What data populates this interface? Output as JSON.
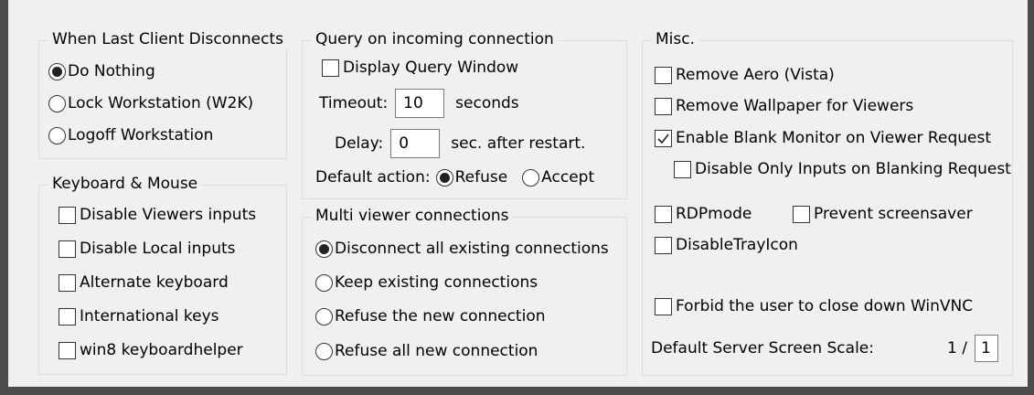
{
  "last_client": {
    "title": "When Last Client Disconnects",
    "options": [
      {
        "label": "Do Nothing",
        "selected": true
      },
      {
        "label": "Lock Workstation (W2K)",
        "selected": false
      },
      {
        "label": "Logoff Workstation",
        "selected": false
      }
    ]
  },
  "keyboard_mouse": {
    "title": "Keyboard & Mouse",
    "items": [
      {
        "label": "Disable Viewers inputs",
        "checked": false
      },
      {
        "label": "Disable Local inputs",
        "checked": false
      },
      {
        "label": "Alternate keyboard",
        "checked": false
      },
      {
        "label": "International keys",
        "checked": false
      },
      {
        "label": "win8 keyboardhelper",
        "checked": false
      }
    ]
  },
  "query": {
    "title": "Query on incoming connection",
    "display_query_window": {
      "label": "Display Query Window",
      "checked": false
    },
    "timeout_label": "Timeout:",
    "timeout_value": "10",
    "timeout_unit": "seconds",
    "delay_label": "Delay:",
    "delay_value": "0",
    "delay_unit": "sec. after restart.",
    "default_action_label": "Default action:",
    "actions": [
      {
        "label": "Refuse",
        "selected": true
      },
      {
        "label": "Accept",
        "selected": false
      }
    ]
  },
  "multi_viewer": {
    "title": "Multi viewer connections",
    "options": [
      {
        "label": "Disconnect all existing connections",
        "selected": true
      },
      {
        "label": "Keep existing connections",
        "selected": false
      },
      {
        "label": "Refuse the new connection",
        "selected": false
      },
      {
        "label": "Refuse all new connection",
        "selected": false
      }
    ]
  },
  "misc": {
    "title": "Misc.",
    "remove_aero": {
      "label": "Remove Aero (Vista)",
      "checked": false
    },
    "remove_wallpaper": {
      "label": "Remove Wallpaper for Viewers",
      "checked": false
    },
    "enable_blank": {
      "label": "Enable Blank Monitor on Viewer Request",
      "checked": true
    },
    "disable_only_inputs": {
      "label": "Disable Only Inputs on Blanking Request",
      "checked": false
    },
    "rdpmode": {
      "label": "RDPmode",
      "checked": false
    },
    "prevent_screensaver": {
      "label": "Prevent screensaver",
      "checked": false
    },
    "disable_tray_icon": {
      "label": "DisableTrayIcon",
      "checked": false
    },
    "forbid_close": {
      "label": "Forbid the user to close down WinVNC",
      "checked": false
    },
    "scale_label": "Default Server Screen Scale:",
    "scale_prefix": "1 /",
    "scale_value": "1"
  }
}
